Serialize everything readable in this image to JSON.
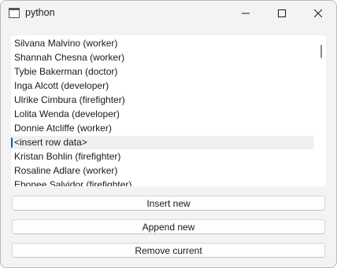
{
  "window": {
    "title": "python"
  },
  "list": {
    "items": [
      "Silvana Malvino (worker)",
      "Shannah Chesna (worker)",
      "Tybie Bakerman (doctor)",
      "Inga Alcott (developer)",
      "Ulrike Cimbura (firefighter)",
      "Lolita Wenda (developer)",
      "Donnie Atcliffe (worker)",
      "<insert row data>",
      "Kristan Bohlin (firefighter)",
      "Rosaline Adlare (worker)",
      "Ebonee Salvidor (firefighter)"
    ],
    "current_index": 7
  },
  "buttons": {
    "insert": "Insert new",
    "append": "Append new",
    "remove": "Remove current"
  },
  "colors": {
    "accent": "#005fb8",
    "window_bg": "#f3f3f3",
    "list_bg": "#ffffff"
  }
}
